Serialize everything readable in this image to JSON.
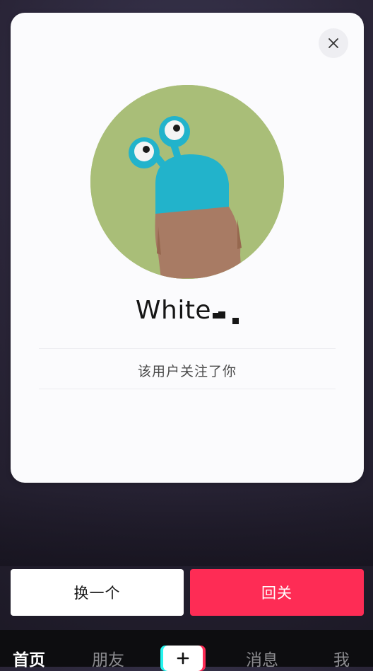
{
  "dialog": {
    "username": "White",
    "follow_note": "该用户关注了你",
    "close_icon": "close-icon"
  },
  "actions": {
    "switch_label": "换一个",
    "follow_back_label": "回关"
  },
  "bottom_nav": {
    "items": [
      {
        "label": "首页",
        "active": true
      },
      {
        "label": "朋友",
        "active": false
      },
      {
        "label": "消息",
        "active": false
      },
      {
        "label": "我",
        "active": false
      }
    ],
    "create_icon": "plus-icon"
  },
  "colors": {
    "accent": "#fe2c55",
    "cyan": "#25f4ee",
    "avatar_bg": "#a9be78",
    "character_blue": "#22b3cb",
    "character_brown": "#a87b64"
  }
}
